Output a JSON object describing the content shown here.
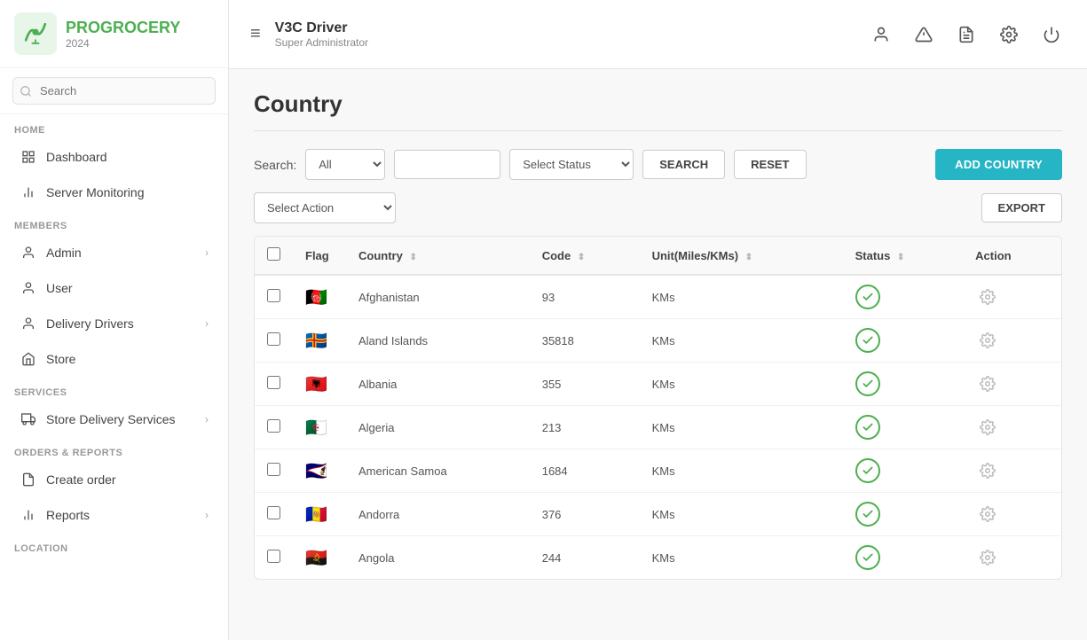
{
  "app": {
    "name_pro": "PRO",
    "name_grocery": "GROCERY",
    "year": "2024"
  },
  "sidebar": {
    "search_placeholder": "Search",
    "sections": [
      {
        "label": "HOME",
        "items": [
          {
            "id": "dashboard",
            "label": "Dashboard",
            "icon": "grid",
            "chevron": false
          },
          {
            "id": "server-monitoring",
            "label": "Server Monitoring",
            "icon": "chart-bar",
            "chevron": false
          }
        ]
      },
      {
        "label": "MEMBERS",
        "items": [
          {
            "id": "admin",
            "label": "Admin",
            "icon": "user-admin",
            "chevron": true
          },
          {
            "id": "user",
            "label": "User",
            "icon": "user",
            "chevron": false
          },
          {
            "id": "delivery-drivers",
            "label": "Delivery Drivers",
            "icon": "user-driver",
            "chevron": true
          },
          {
            "id": "store",
            "label": "Store",
            "icon": "store",
            "chevron": false
          }
        ]
      },
      {
        "label": "SERVICES",
        "items": [
          {
            "id": "store-delivery-services",
            "label": "Store Delivery Services",
            "icon": "truck",
            "chevron": true
          }
        ]
      },
      {
        "label": "ORDERS & REPORTS",
        "items": [
          {
            "id": "create-order",
            "label": "Create order",
            "icon": "doc",
            "chevron": false
          },
          {
            "id": "reports",
            "label": "Reports",
            "icon": "chart",
            "chevron": true
          }
        ]
      },
      {
        "label": "LOCATION",
        "items": []
      }
    ]
  },
  "header": {
    "title": "V3C Driver",
    "subtitle": "Super Administrator",
    "menu_icon": "≡"
  },
  "page": {
    "title": "Country"
  },
  "toolbar": {
    "search_label": "Search:",
    "select_all_options": [
      "All"
    ],
    "select_all_default": "All",
    "search_input_value": "",
    "select_status_default": "Select Status",
    "btn_search": "SEARCH",
    "btn_reset": "RESET",
    "btn_add_country": "ADD COUNTRY",
    "select_action_default": "Select Action",
    "btn_export": "EXPORT"
  },
  "table": {
    "columns": [
      {
        "id": "check",
        "label": ""
      },
      {
        "id": "flag",
        "label": "Flag"
      },
      {
        "id": "country",
        "label": "Country",
        "sortable": true
      },
      {
        "id": "code",
        "label": "Code",
        "sortable": true
      },
      {
        "id": "unit",
        "label": "Unit(Miles/KMs)",
        "sortable": true
      },
      {
        "id": "status",
        "label": "Status",
        "sortable": true
      },
      {
        "id": "action",
        "label": "Action"
      }
    ],
    "rows": [
      {
        "country": "Afghanistan",
        "code": "93",
        "unit": "KMs",
        "status": "active",
        "flag_color": "#888",
        "flag_emoji": "🇦🇫"
      },
      {
        "country": "Aland Islands",
        "code": "35818",
        "unit": "KMs",
        "status": "active",
        "flag_color": "#4a90d9",
        "flag_emoji": "🇦🇽"
      },
      {
        "country": "Albania",
        "code": "355",
        "unit": "KMs",
        "status": "active",
        "flag_color": "#d9534f",
        "flag_emoji": "🇦🇱"
      },
      {
        "country": "Algeria",
        "code": "213",
        "unit": "KMs",
        "status": "active",
        "flag_color": "#2e7d32",
        "flag_emoji": "🇩🇿"
      },
      {
        "country": "American Samoa",
        "code": "1684",
        "unit": "KMs",
        "status": "active",
        "flag_color": "#1a237e",
        "flag_emoji": "🇦🇸"
      },
      {
        "country": "Andorra",
        "code": "376",
        "unit": "KMs",
        "status": "active",
        "flag_color": "#e53935",
        "flag_emoji": "🇦🇩"
      },
      {
        "country": "Angola",
        "code": "244",
        "unit": "KMs",
        "status": "active",
        "flag_color": "#d32f2f",
        "flag_emoji": "🇦🇴"
      }
    ]
  }
}
